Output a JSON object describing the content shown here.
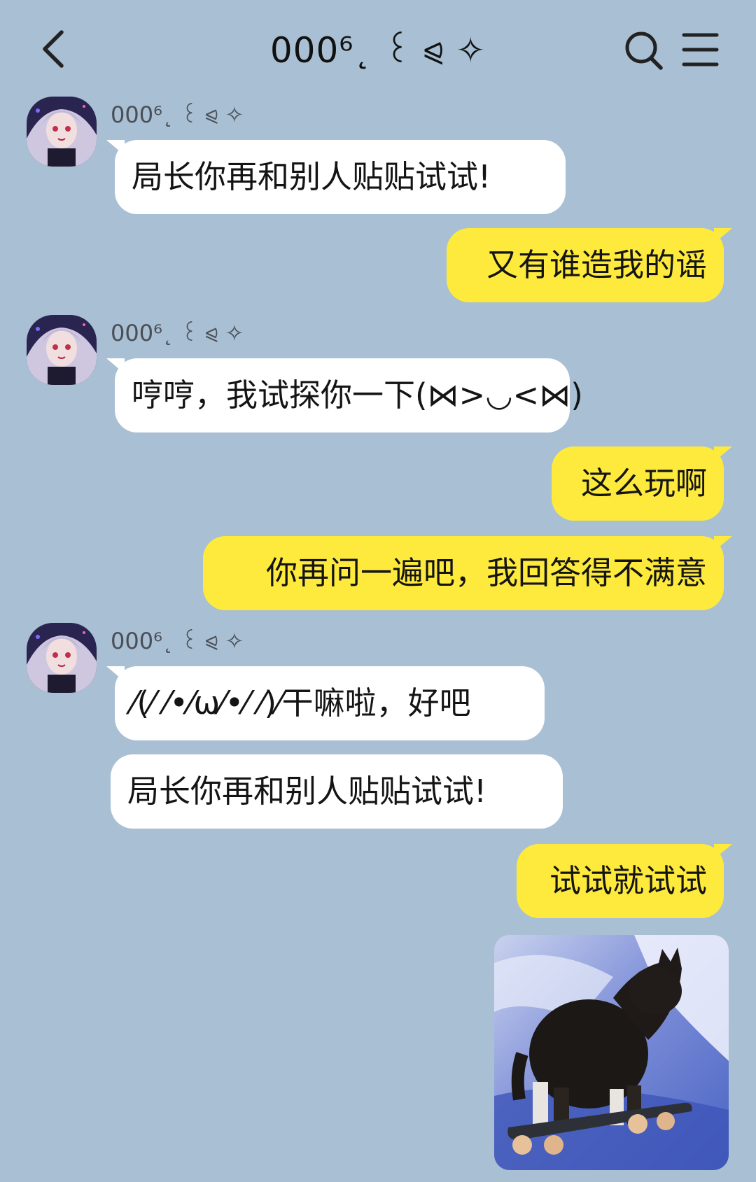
{
  "header": {
    "title": "000⁶˛ ꒰ ⪨ ✧",
    "back_icon": "chevron-left-icon",
    "search_icon": "search-icon",
    "menu_icon": "menu-icon"
  },
  "colors": {
    "background": "#a9bfd3",
    "incoming_bubble": "#ffffff",
    "outgoing_bubble": "#fdea3c"
  },
  "messages": [
    {
      "direction": "incoming",
      "sender": "000⁶˛ ꒰ ⪨ ✧",
      "text": "局长你再和别人贴贴试试!"
    },
    {
      "direction": "outgoing",
      "text": "又有谁造我的谣"
    },
    {
      "direction": "incoming",
      "sender": "000⁶˛ ꒰ ⪨ ✧",
      "text": "哼哼，我试探你一下(⋈>◡<⋈)"
    },
    {
      "direction": "outgoing",
      "text": "这么玩啊"
    },
    {
      "direction": "outgoing",
      "text": "你再问一遍吧，我回答得不满意"
    },
    {
      "direction": "incoming",
      "sender": "000⁶˛ ꒰ ⪨ ✧",
      "text": "⁄(⁄ ⁄•⁄ω⁄•⁄ ⁄)⁄干嘛啦，好吧"
    },
    {
      "direction": "incoming",
      "text": "局长你再和别人贴贴试试!"
    },
    {
      "direction": "outgoing",
      "text": "试试就试试"
    },
    {
      "direction": "outgoing",
      "type": "image",
      "image": "cat-on-skateboard-sticker"
    }
  ]
}
